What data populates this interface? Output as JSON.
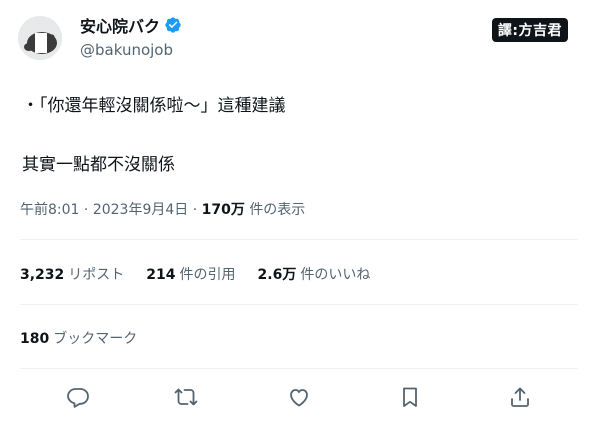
{
  "author": {
    "display_name": "安心院バク",
    "handle": "@bakunojob"
  },
  "translator_tag": "譯:方吉君",
  "tweet": {
    "line1": "・「你還年輕沒關係啦〜」這種建議",
    "line2": "其實一點都不沒關係"
  },
  "meta": {
    "time": "午前8:01",
    "date": "2023年9月4日",
    "views_count": "170万",
    "views_label": "件の表示",
    "separator": "·"
  },
  "stats": {
    "reposts_count": "3,232",
    "reposts_label": "リポスト",
    "quotes_count": "214",
    "quotes_label": "件の引用",
    "likes_count": "2.6万",
    "likes_label": "件のいいね"
  },
  "bookmarks": {
    "count": "180",
    "label": "ブックマーク"
  },
  "icons": {
    "reply": "reply-icon",
    "retweet": "retweet-icon",
    "like": "heart-icon",
    "bookmark": "bookmark-icon",
    "share": "share-icon",
    "verified": "verified-badge-icon"
  },
  "colors": {
    "verified_blue": "#1d9bf0",
    "secondary_text": "#536471",
    "primary_text": "#0f1419"
  }
}
